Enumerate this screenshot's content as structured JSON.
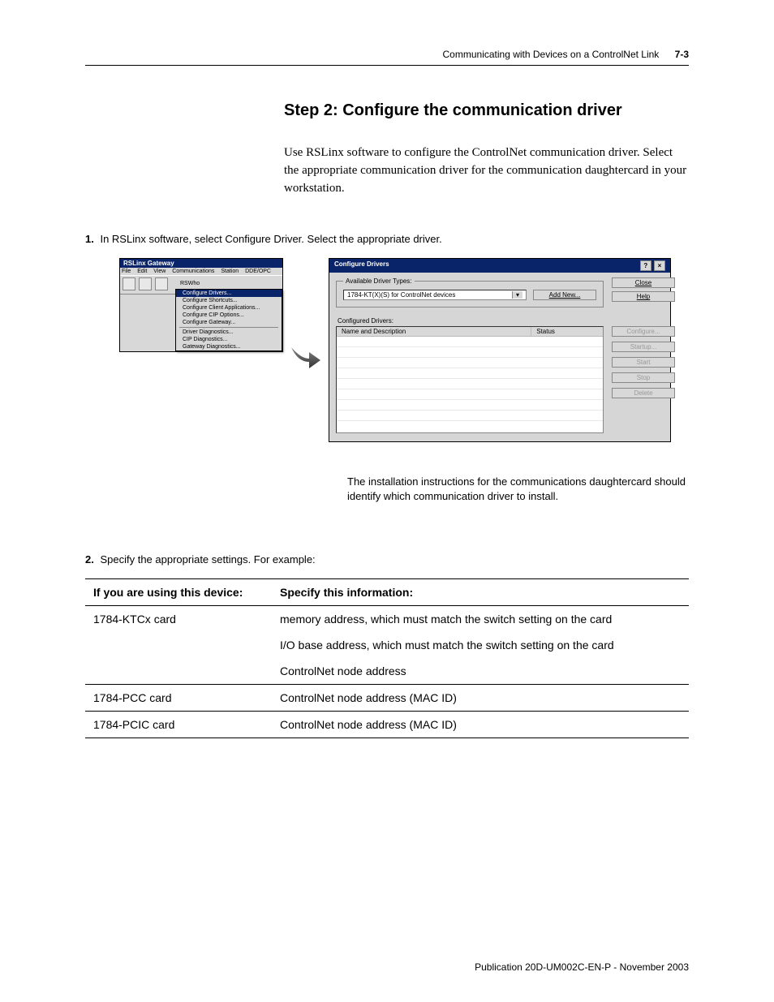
{
  "header": {
    "section_title": "Communicating with Devices on a ControlNet Link",
    "page_number": "7-3"
  },
  "title": "Step 2: Configure the communication driver",
  "intro": "Use RSLinx software to configure the ControlNet communication driver. Select the appropriate communication driver for the communication daughtercard in your workstation.",
  "steps": {
    "s1_num": "1.",
    "s1_text": "In RSLinx software, select Configure Driver. Select the appropriate driver.",
    "s2_num": "2.",
    "s2_text": "Specify the appropriate settings. For example:"
  },
  "rslinx": {
    "title": "RSLinx Gateway",
    "menubar": {
      "file": "File",
      "edit": "Edit",
      "view": "View",
      "comm": "Communications",
      "station": "Station",
      "dde": "DDE/OPC"
    },
    "dd_label": "RSWho",
    "menu": {
      "m1": "Configure Drivers...",
      "m2": "Configure Shortcuts...",
      "m3": "Configure Client Applications...",
      "m4": "Configure CIP Options...",
      "m5": "Configure Gateway...",
      "m6": "Driver Diagnostics...",
      "m7": "CIP Diagnostics...",
      "m8": "Gateway Diagnostics..."
    }
  },
  "dialog": {
    "title": "Configure Drivers",
    "group1": "Available Driver Types:",
    "select_value": "1784-KT(X)(S) for ControlNet devices",
    "addnew": "Add New...",
    "close": "Close",
    "help": "Help",
    "group2": "Configured Drivers:",
    "col1": "Name and Description",
    "col2": "Status",
    "btn_configure": "Configure...",
    "btn_startup": "Startup...",
    "btn_start": "Start",
    "btn_stop": "Stop",
    "btn_delete": "Delete"
  },
  "caption": "The installation instructions for the communications daughtercard should identify which communication driver to install.",
  "table": {
    "h1": "If you are using this device:",
    "h2": "Specify this information:",
    "r1c1": "1784-KTCx card",
    "r1c2a": "memory address, which must match the switch setting on the card",
    "r1c2b": "I/O base address, which must match the switch setting on the card",
    "r1c2c": "ControlNet node address",
    "r2c1": "1784-PCC card",
    "r2c2": "ControlNet node address (MAC ID)",
    "r3c1": "1784-PCIC card",
    "r3c2": "ControlNet node address (MAC ID)"
  },
  "footer": "Publication 20D-UM002C-EN-P - November 2003"
}
